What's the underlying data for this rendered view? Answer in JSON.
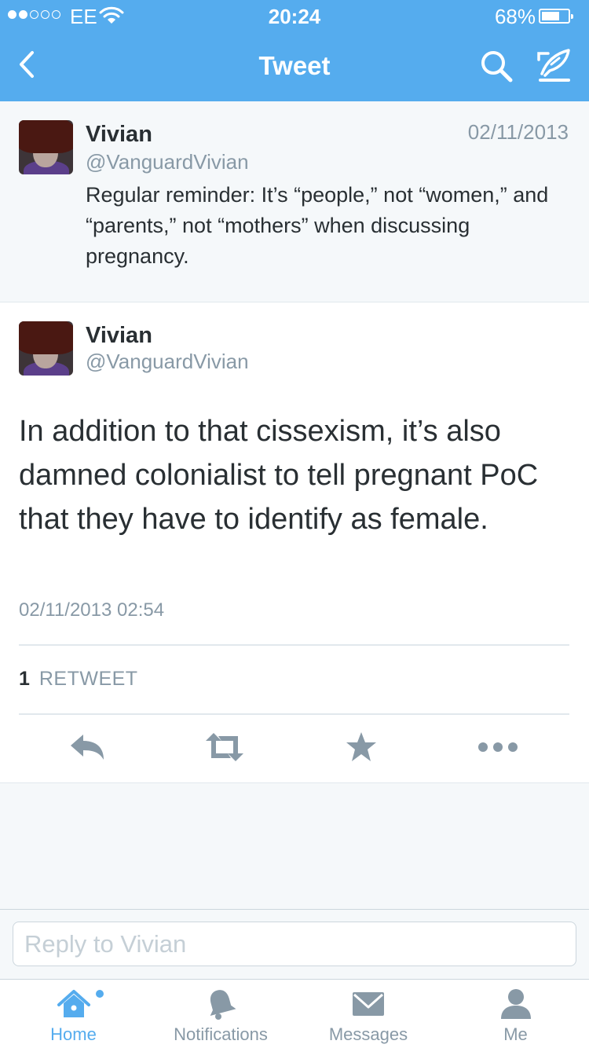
{
  "status_bar": {
    "carrier": "EE",
    "time": "20:24",
    "battery_percent": "68%",
    "battery_level": 0.68,
    "signal_bars_filled": 2,
    "signal_bars_total": 5
  },
  "nav": {
    "title": "Tweet",
    "back_icon": "chevron-left-icon",
    "search_icon": "search-icon",
    "compose_icon": "compose-icon"
  },
  "parent_tweet": {
    "name": "Vivian",
    "handle": "@VanguardVivian",
    "date": "02/11/2013",
    "text": "Regular reminder: It’s “people,” not “women,” and “parents,” not “mothers” when discussing pregnancy."
  },
  "main_tweet": {
    "name": "Vivian",
    "handle": "@VanguardVivian",
    "text": "In addition to that cissexism, it’s also damned colonialist to tell pregnant PoC that they have to identify as female.",
    "timestamp": "02/11/2013 02:54",
    "retweet_count": "1",
    "retweet_label": "RETWEET",
    "actions": [
      "reply-icon",
      "retweet-icon",
      "favorite-icon",
      "more-icon"
    ]
  },
  "reply": {
    "placeholder": "Reply to Vivian"
  },
  "tabs": [
    {
      "label": "Home",
      "icon": "home-icon",
      "active": true
    },
    {
      "label": "Notifications",
      "icon": "bell-icon",
      "active": false
    },
    {
      "label": "Messages",
      "icon": "envelope-icon",
      "active": false
    },
    {
      "label": "Me",
      "icon": "person-icon",
      "active": false
    }
  ],
  "colors": {
    "brand": "#55acee",
    "icon_gray": "#8899a6",
    "text": "#292f33",
    "background": "#f5f8fa"
  }
}
